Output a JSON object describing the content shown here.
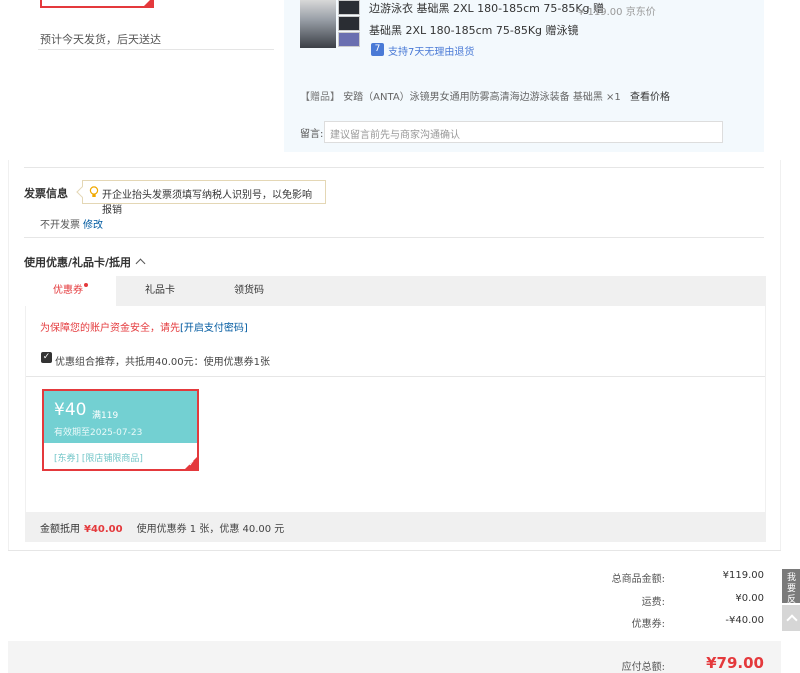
{
  "shipping": {
    "estimate": "预计今天发货，后天送达"
  },
  "product": {
    "name": "边游泳衣 基础黑 2XL 180-185cm 75-85Kg 赠",
    "spec": "基础黑 2XL 180-185cm 75-85Kg 赠泳镜",
    "price": "¥ 119.00 京东价",
    "return_icon": "7",
    "return_policy": "支持7天无理由退货",
    "gift_tag": "【赠品】",
    "gift_name": "安踏（ANTA）泳镜男女通用防雾高清海边游泳装备 基础黑 ×1",
    "gift_link": "查看价格",
    "memo_label": "留言:",
    "memo_placeholder": "建议留言前先与商家沟通确认"
  },
  "invoice": {
    "title": "发票信息",
    "tip": "开企业抬头发票须填写纳税人识别号，以免影响报销",
    "status": "不开发票",
    "edit_link": "修改"
  },
  "coupon_section": {
    "title": "使用优惠/礼品卡/抵用",
    "tabs": [
      {
        "label": "优惠券"
      },
      {
        "label": "礼品卡"
      },
      {
        "label": "领货码"
      }
    ],
    "safe_tip": "为保障您的账户资金安全，请先",
    "safe_link": "[开启支付密码]",
    "combo_text": "优惠组合推荐，共抵用40.00元：使用优惠券1张",
    "coupon": {
      "amount": "¥40",
      "condition": "满119",
      "expiry": "有效期至2025-07-23",
      "scope": "[东券] [限店铺限商品]",
      "tick": "✓"
    },
    "summary_label": "金额抵用",
    "summary_amount": "¥40.00",
    "summary_desc": "使用优惠券 1 张，优惠 40.00 元"
  },
  "totals": {
    "goods_label": "总商品金额:",
    "goods_value": "¥119.00",
    "shipping_label": "运费:",
    "shipping_value": "¥0.00",
    "coupon_label": "优惠券:",
    "coupon_value": "-¥40.00",
    "payable_label": "应付总额:",
    "payable_value": "¥79.00"
  },
  "side": {
    "feedback": "我要反馈"
  },
  "colors": {
    "accent_red": "#e4393c",
    "link_blue": "#005aa0",
    "coupon_teal": "#73d0d2"
  }
}
